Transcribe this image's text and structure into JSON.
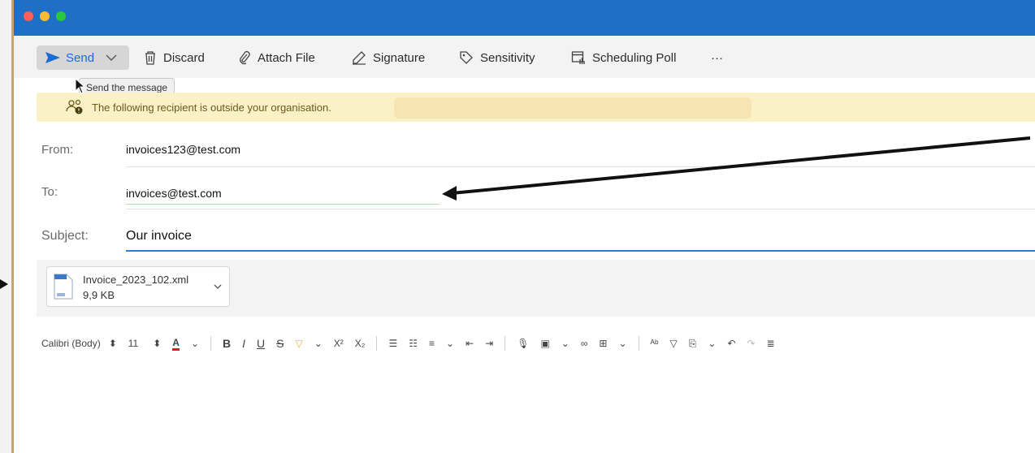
{
  "toolbar": {
    "send_label": "Send",
    "discard_label": "Discard",
    "attach_label": "Attach File",
    "signature_label": "Signature",
    "sensitivity_label": "Sensitivity",
    "poll_label": "Scheduling Poll",
    "more_label": "···"
  },
  "tooltip": "Send the message",
  "warning": {
    "text": "The following recipient is outside your organisation."
  },
  "fields": {
    "from_label": "From:",
    "from_value": "invoices123@test.com",
    "to_label": "To:",
    "to_value": "invoices@test.com",
    "subject_label": "Subject:",
    "subject_value": "Our invoice"
  },
  "attachment": {
    "name": "Invoice_2023_102.xml",
    "size": "9,9 KB"
  },
  "format": {
    "font": "Calibri (Body)",
    "size": "11"
  },
  "colors": {
    "accent": "#1f6fc7",
    "send": "#1a6ad8",
    "warning_bg": "#fbf1c7"
  }
}
